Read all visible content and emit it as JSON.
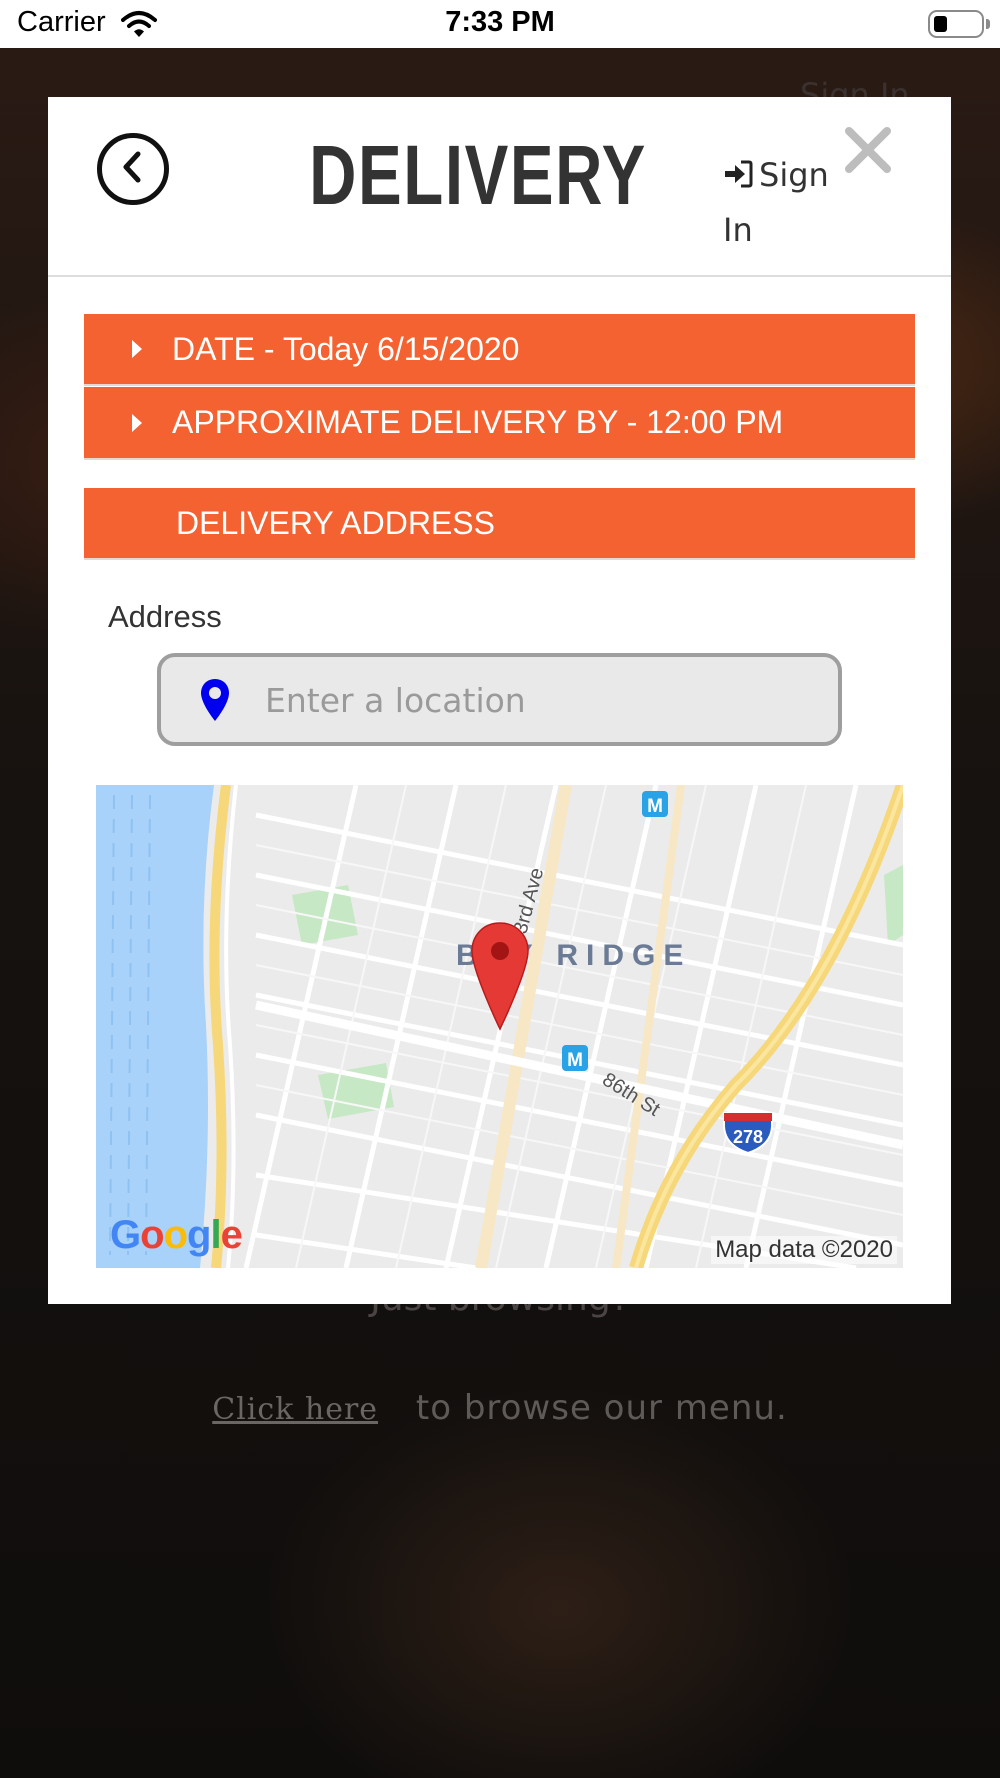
{
  "status_bar": {
    "carrier": "Carrier",
    "time": "7:33 PM"
  },
  "background_page": {
    "header_signin": "Sign In",
    "browsing_text": "Just browsing?",
    "click_link": "Click here",
    "click_suffix": "to browse our menu."
  },
  "modal": {
    "title": "DELIVERY",
    "sign_in_label": "Sign In",
    "date_bar": "DATE - Today 6/15/2020",
    "approx_bar": "APPROXIMATE DELIVERY BY - 12:00 PM",
    "address_section": "DELIVERY ADDRESS",
    "address_label": "Address",
    "location_input": {
      "value": "",
      "placeholder": "Enter a location"
    },
    "map": {
      "neighborhood_label": "BAY RIDGE",
      "street_labels": [
        "3rd Ave",
        "86th St"
      ],
      "highway_shield": "278",
      "transit_icon": "M",
      "attribution": "Map data ©2020",
      "logo": [
        "G",
        "o",
        "o",
        "g",
        "l",
        "e"
      ]
    }
  },
  "colors": {
    "accent_orange": "#f46231",
    "pin_blue": "#0000ee",
    "map_marker_red": "#e53935"
  },
  "icons": {
    "back": "chevron-left-circle",
    "sign_in": "sign-in-arrow",
    "close": "x-mark",
    "caret": "triangle-right",
    "location": "map-pin"
  }
}
